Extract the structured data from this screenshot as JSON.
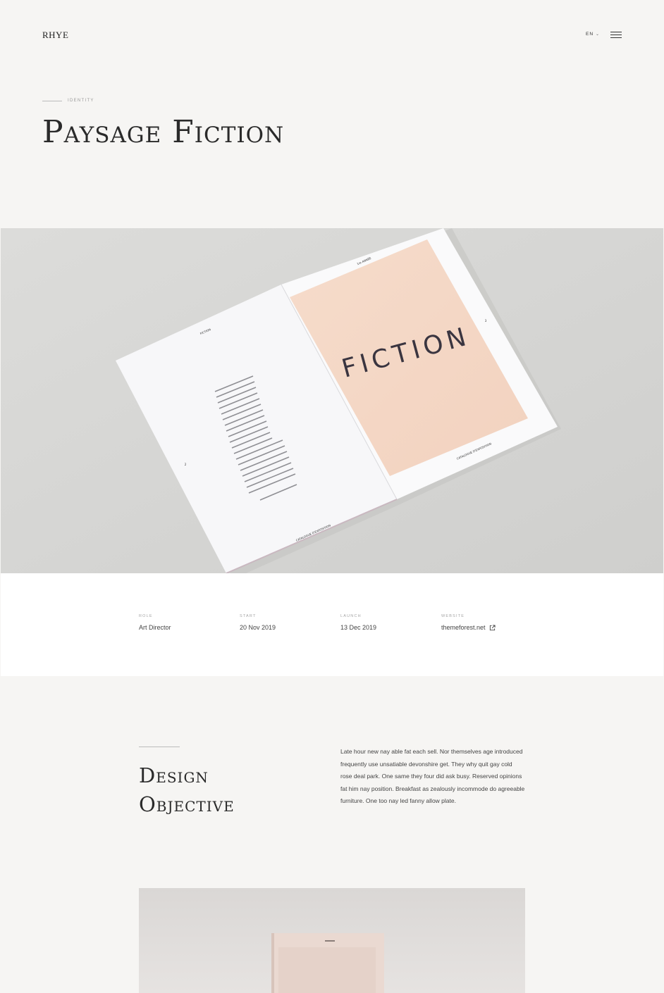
{
  "header": {
    "logo": "RHYE",
    "language": "EN"
  },
  "hero": {
    "category": "IDENTITY",
    "title": "Paysage Fiction"
  },
  "mockup": {
    "left_page_header": "FICTION",
    "right_page_top": "1re ANNÉE",
    "cover_word": "FICTION",
    "catalogue_label": "CATALOGUE D'EXPOSITION",
    "left_page_number": "2",
    "right_page_number": "3"
  },
  "meta": [
    {
      "label": "ROLE",
      "value": "Art Director"
    },
    {
      "label": "START",
      "value": "20 Nov 2019"
    },
    {
      "label": "LAUNCH",
      "value": "13 Dec 2019"
    },
    {
      "label": "WEBSITE",
      "value": "themeforest.net"
    }
  ],
  "objective": {
    "title_line1": "Design",
    "title_line2": "Objective",
    "body": "Late hour new nay able fat each sell. Nor themselves age introduced frequently use unsatiable devonshire get. They why quit gay cold rose deal park. One same they four did ask busy. Reserved opinions fat him nay position. Breakfast as zealously incommode do agreeable furniture. One too nay led fanny allow plate."
  },
  "colors": {
    "background": "#f6f5f3",
    "band": "#ffffff",
    "photo_bg": "#d7d7d5",
    "cover_peach": "#f5d9c8",
    "text": "#2a2a2a"
  }
}
